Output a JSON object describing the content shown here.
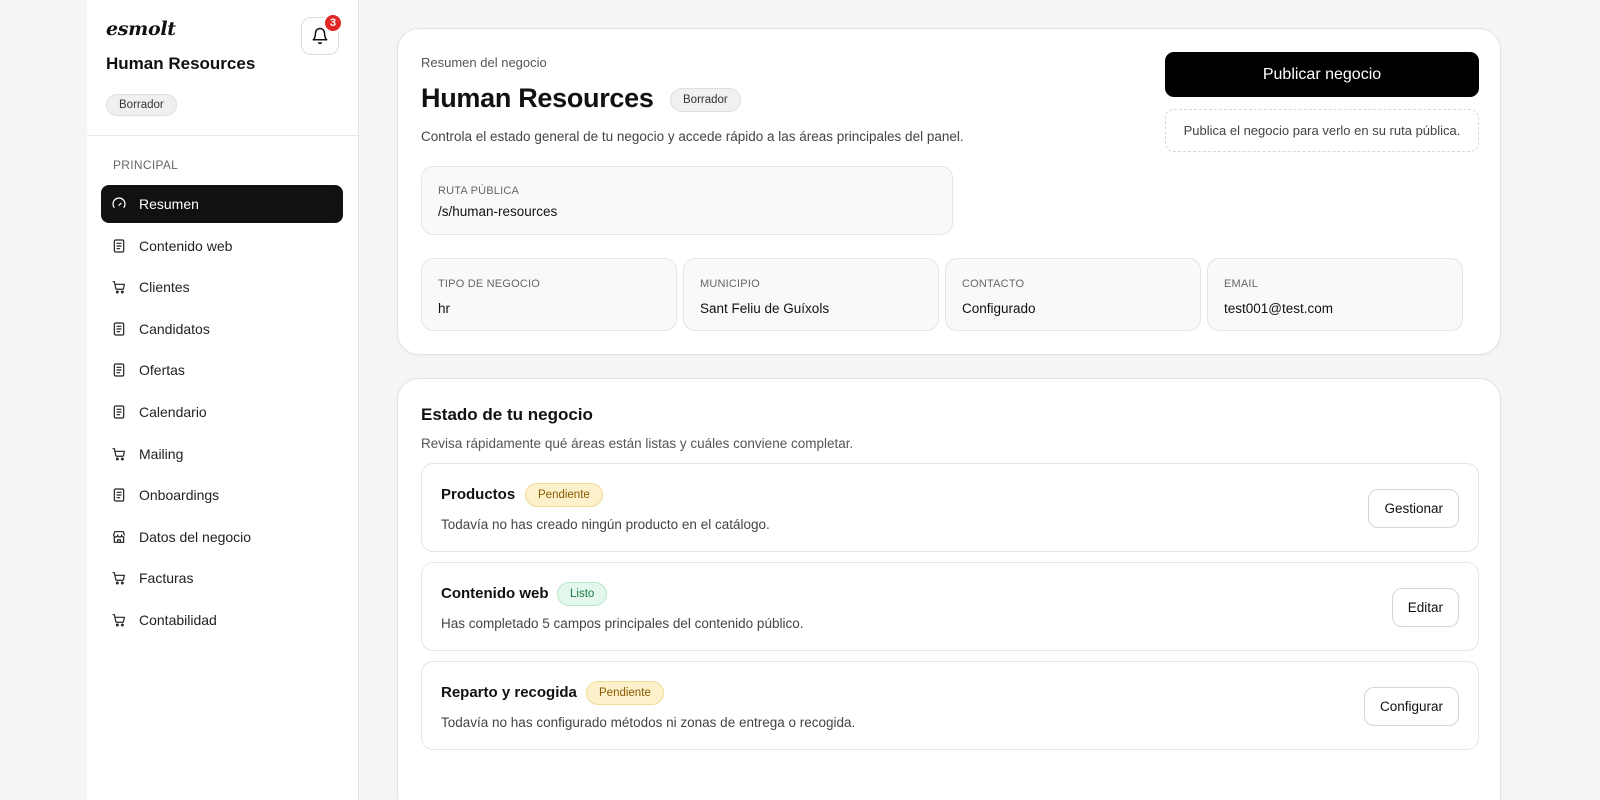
{
  "app": {
    "logo": "esmolt",
    "notifications_count": "3"
  },
  "sidebar": {
    "business_name": "Human Resources",
    "status_badge": "Borrador",
    "section_label": "PRINCIPAL",
    "items": [
      {
        "label": "Resumen",
        "icon": "gauge-icon",
        "active": true
      },
      {
        "label": "Contenido web",
        "icon": "document-icon"
      },
      {
        "label": "Clientes",
        "icon": "cart-icon"
      },
      {
        "label": "Candidatos",
        "icon": "document-icon"
      },
      {
        "label": "Ofertas",
        "icon": "document-icon"
      },
      {
        "label": "Calendario",
        "icon": "document-icon"
      },
      {
        "label": "Mailing",
        "icon": "cart-icon"
      },
      {
        "label": "Onboardings",
        "icon": "document-icon"
      },
      {
        "label": "Datos del negocio",
        "icon": "store-icon"
      },
      {
        "label": "Facturas",
        "icon": "cart-icon"
      },
      {
        "label": "Contabilidad",
        "icon": "cart-icon"
      }
    ]
  },
  "summary": {
    "kicker": "Resumen del negocio",
    "title": "Human Resources",
    "badge": "Borrador",
    "description": "Controla el estado general de tu negocio y accede rápido a las áreas principales del panel.",
    "publish_button": "Publicar negocio",
    "publish_note": "Publica el negocio para verlo en su ruta pública.",
    "route": {
      "label": "RUTA PÚBLICA",
      "value": "/s/human-resources"
    },
    "fields": [
      {
        "label": "TIPO DE NEGOCIO",
        "value": "hr"
      },
      {
        "label": "MUNICIPIO",
        "value": "Sant Feliu de Guíxols"
      },
      {
        "label": "CONTACTO",
        "value": "Configurado"
      },
      {
        "label": "EMAIL",
        "value": "test001@test.com"
      }
    ]
  },
  "status": {
    "title": "Estado de tu negocio",
    "description": "Revisa rápidamente qué áreas están listas y cuáles conviene completar.",
    "rows": [
      {
        "title": "Productos",
        "badge": "Pendiente",
        "badge_type": "pending",
        "description": "Todavía no has creado ningún producto en el catálogo.",
        "action": "Gestionar"
      },
      {
        "title": "Contenido web",
        "badge": "Listo",
        "badge_type": "ready",
        "description": "Has completado 5 campos principales del contenido público.",
        "action": "Editar"
      },
      {
        "title": "Reparto y recogida",
        "badge": "Pendiente",
        "badge_type": "pending",
        "description": "Todavía no has configurado métodos ni zonas de entrega o recogida.",
        "action": "Configurar"
      }
    ]
  },
  "colors": {
    "primary": "#000000",
    "pending_bg": "#fdf1cc",
    "ready_bg": "#e3f7ec",
    "badge_red": "#e22626"
  }
}
